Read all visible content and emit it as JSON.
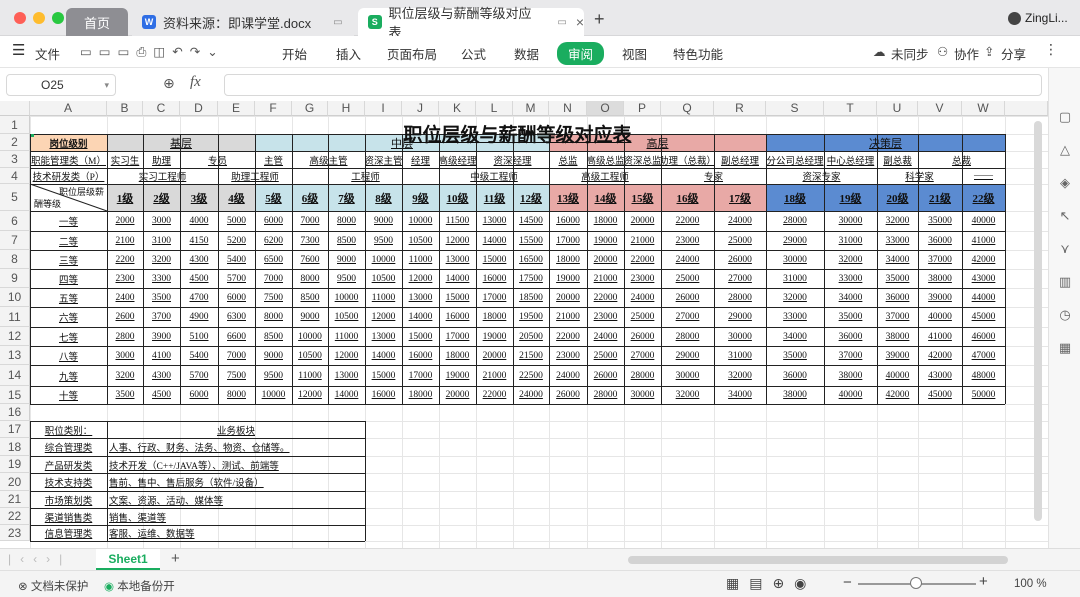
{
  "window": {
    "tabs": [
      {
        "label": "首页",
        "kind": "home"
      },
      {
        "label": "资料来源：即课学堂.docx",
        "kind": "word"
      },
      {
        "label": "职位层级与薪酬等级对应表",
        "kind": "sheet",
        "active": true
      }
    ],
    "user": "ZingLi...",
    "new_tab": "+"
  },
  "menu": {
    "file": "文件",
    "tabs": [
      "开始",
      "插入",
      "页面布局",
      "公式",
      "数据",
      "审阅",
      "视图",
      "特色功能"
    ],
    "active_tab": "审阅",
    "right": [
      "未同步",
      "协作",
      "分享"
    ]
  },
  "formula_bar": {
    "cell_ref": "O25",
    "fx": "fx",
    "value": ""
  },
  "grid": {
    "columns": [
      "A",
      "B",
      "C",
      "D",
      "E",
      "F",
      "G",
      "H",
      "I",
      "J",
      "K",
      "L",
      "M",
      "N",
      "O",
      "P",
      "Q",
      "R",
      "S",
      "T",
      "U",
      "V",
      "W"
    ],
    "rows": [
      "1",
      "2",
      "3",
      "4",
      "5",
      "6",
      "7",
      "8",
      "9",
      "10",
      "11",
      "12",
      "13",
      "14",
      "15",
      "16",
      "17",
      "18",
      "19",
      "20",
      "21",
      "22",
      "23"
    ]
  },
  "sheet_title": "职位层级与薪酬等级对应表",
  "row2": {
    "label": "岗位级别",
    "groups": [
      "基层",
      "中层",
      "高层",
      "决策层"
    ]
  },
  "row3": {
    "label": "职能管理类（M）",
    "items": [
      "实习生",
      "助理",
      "专员",
      "主管",
      "高级主管",
      "资深主管",
      "经理",
      "高级经理",
      "资深经理",
      "总监",
      "高级总监",
      "资深总监",
      "助理（总裁）",
      "副总经理",
      "分公司总经理",
      "中心总经理",
      "副总裁",
      "总裁"
    ]
  },
  "row4": {
    "label": "技术研发类（P）",
    "items": [
      "实习工程师",
      "助理工程师",
      "工程师",
      "中级工程师",
      "高级工程师",
      "专家",
      "资深专家",
      "科学家",
      "——"
    ]
  },
  "row5": {
    "diag_top": "职位层级薪",
    "diag_bottom": "酬等级",
    "grades": [
      "1级",
      "2级",
      "3级",
      "4级",
      "5级",
      "6级",
      "7级",
      "8级",
      "9级",
      "10级",
      "11级",
      "12级",
      "13级",
      "14级",
      "15级",
      "16级",
      "17级",
      "18级",
      "19级",
      "20级",
      "21级",
      "22级"
    ]
  },
  "pay_rows": [
    {
      "level": "一等",
      "values": [
        "2000",
        "3000",
        "4000",
        "5000",
        "6000",
        "7000",
        "8000",
        "9000",
        "10000",
        "11500",
        "13000",
        "14500",
        "16000",
        "18000",
        "20000",
        "22000",
        "24000",
        "28000",
        "30000",
        "32000",
        "35000",
        "40000"
      ]
    },
    {
      "level": "二等",
      "values": [
        "2100",
        "3100",
        "4150",
        "5200",
        "6200",
        "7300",
        "8500",
        "9500",
        "10500",
        "12000",
        "14000",
        "15500",
        "17000",
        "19000",
        "21000",
        "23000",
        "25000",
        "29000",
        "31000",
        "33000",
        "36000",
        "41000"
      ]
    },
    {
      "level": "三等",
      "values": [
        "2200",
        "3200",
        "4300",
        "5400",
        "6500",
        "7600",
        "9000",
        "10000",
        "11000",
        "13000",
        "15000",
        "16500",
        "18000",
        "20000",
        "22000",
        "24000",
        "26000",
        "30000",
        "32000",
        "34000",
        "37000",
        "42000"
      ]
    },
    {
      "level": "四等",
      "values": [
        "2300",
        "3300",
        "4500",
        "5700",
        "7000",
        "8000",
        "9500",
        "10500",
        "12000",
        "14000",
        "16000",
        "17500",
        "19000",
        "21000",
        "23000",
        "25000",
        "27000",
        "31000",
        "33000",
        "35000",
        "38000",
        "43000"
      ]
    },
    {
      "level": "五等",
      "values": [
        "2400",
        "3500",
        "4700",
        "6000",
        "7500",
        "8500",
        "10000",
        "11000",
        "13000",
        "15000",
        "17000",
        "18500",
        "20000",
        "22000",
        "24000",
        "26000",
        "28000",
        "32000",
        "34000",
        "36000",
        "39000",
        "44000"
      ]
    },
    {
      "level": "六等",
      "values": [
        "2600",
        "3700",
        "4900",
        "6300",
        "8000",
        "9000",
        "10500",
        "12000",
        "14000",
        "16000",
        "18000",
        "19500",
        "21000",
        "23000",
        "25000",
        "27000",
        "29000",
        "33000",
        "35000",
        "37000",
        "40000",
        "45000"
      ]
    },
    {
      "level": "七等",
      "values": [
        "2800",
        "3900",
        "5100",
        "6600",
        "8500",
        "10000",
        "11000",
        "13000",
        "15000",
        "17000",
        "19000",
        "20500",
        "22000",
        "24000",
        "26000",
        "28000",
        "30000",
        "34000",
        "36000",
        "38000",
        "41000",
        "46000"
      ]
    },
    {
      "level": "八等",
      "values": [
        "3000",
        "4100",
        "5400",
        "7000",
        "9000",
        "10500",
        "12000",
        "14000",
        "16000",
        "18000",
        "20000",
        "21500",
        "23000",
        "25000",
        "27000",
        "29000",
        "31000",
        "35000",
        "37000",
        "39000",
        "42000",
        "47000"
      ]
    },
    {
      "level": "九等",
      "values": [
        "3200",
        "4300",
        "5700",
        "7500",
        "9500",
        "11000",
        "13000",
        "15000",
        "17000",
        "19000",
        "21000",
        "22500",
        "24000",
        "26000",
        "28000",
        "30000",
        "32000",
        "36000",
        "38000",
        "40000",
        "43000",
        "48000"
      ]
    },
    {
      "level": "十等",
      "values": [
        "3500",
        "4500",
        "6000",
        "8000",
        "10000",
        "12000",
        "14000",
        "16000",
        "18000",
        "20000",
        "22000",
        "24000",
        "26000",
        "28000",
        "30000",
        "32000",
        "34000",
        "38000",
        "40000",
        "42000",
        "45000",
        "50000"
      ]
    }
  ],
  "category_table": {
    "header_left": "职位类别：",
    "header_right": "业务板块",
    "rows": [
      {
        "category": "综合管理类",
        "scope": "人事、行政、财务、法务、物资、仓储等。"
      },
      {
        "category": "产品研发类",
        "scope": "技术开发（C++/JAVA等）、测试、前端等"
      },
      {
        "category": "技术支持类",
        "scope": "售前、售中、售后服务（软件/设备）"
      },
      {
        "category": "市场策划类",
        "scope": "文案、资源、活动、媒体等"
      },
      {
        "category": "渠道销售类",
        "scope": "销售、渠道等"
      },
      {
        "category": "信息管理类",
        "scope": "客服、运维、数据等"
      }
    ]
  },
  "sheetbar": {
    "sheet": "Sheet1",
    "add": "+"
  },
  "status": {
    "protect": "文档未保护",
    "backup": "本地备份开",
    "zoom": "100 %"
  },
  "colors": {
    "jiceng": "#d9d9d9",
    "zhongceng": "#c7e3ea",
    "gaoceng": "#e8a9a6",
    "juece": "#5b8bd1",
    "header_orange": "#fcd5b4",
    "accent": "#1aad5f"
  }
}
